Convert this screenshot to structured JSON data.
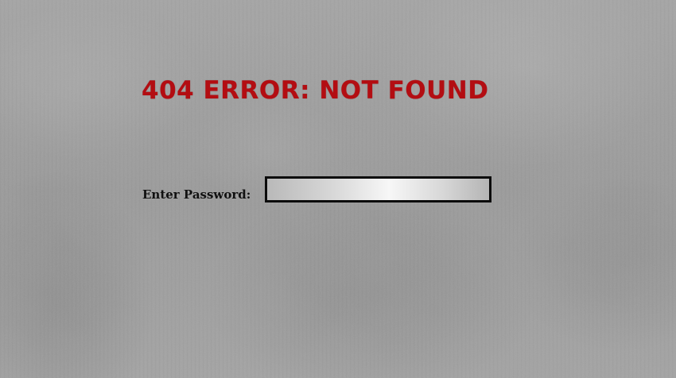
{
  "page": {
    "title": "404 ERROR: NOT FOUND",
    "title_color": "#b30d12",
    "background_color": "#9a9a9a"
  },
  "login": {
    "label": "Enter Password:",
    "value": "",
    "placeholder": "",
    "input_type": "password"
  }
}
